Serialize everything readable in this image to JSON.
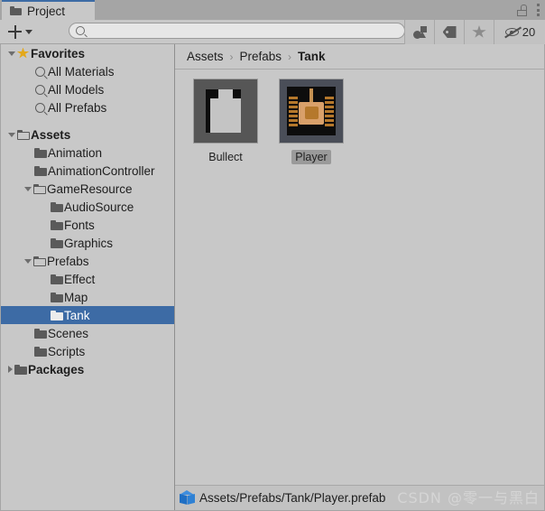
{
  "window": {
    "tab_label": "Project",
    "tab_icon": "folder-icon",
    "lock_icon": "lock-open-icon",
    "menu_icon": "kebab-menu-icon"
  },
  "toolbar": {
    "add_label": "+",
    "add_icon": "plus-icon",
    "add_dropdown_icon": "chevron-down-icon",
    "search": {
      "value": "",
      "placeholder": "",
      "icon": "search-icon"
    },
    "buttons": [
      {
        "name": "filter-by-type-button",
        "icon": "shapes-icon",
        "label": ""
      },
      {
        "name": "filter-by-label-button",
        "icon": "tag-icon",
        "label": ""
      },
      {
        "name": "filter-by-favorite-button",
        "icon": "star-icon",
        "label": ""
      },
      {
        "name": "hidden-items-button",
        "icon": "eye-off-icon",
        "label": "20"
      }
    ],
    "hidden_count": "20"
  },
  "sidebar": {
    "items": [
      {
        "label": "Favorites",
        "icon": "star-icon",
        "indent": 0,
        "twisty": "open",
        "bold": true,
        "selected": false
      },
      {
        "label": "All Materials",
        "icon": "search-icon",
        "indent": 1,
        "twisty": "none",
        "bold": false,
        "selected": false
      },
      {
        "label": "All Models",
        "icon": "search-icon",
        "indent": 1,
        "twisty": "none",
        "bold": false,
        "selected": false
      },
      {
        "label": "All Prefabs",
        "icon": "search-icon",
        "indent": 1,
        "twisty": "none",
        "bold": false,
        "selected": false
      },
      {
        "label": "Assets",
        "icon": "folder-open-icon",
        "indent": 0,
        "twisty": "open",
        "bold": true,
        "selected": false,
        "gap_before": true
      },
      {
        "label": "Animation",
        "icon": "folder-icon",
        "indent": 1,
        "twisty": "none",
        "bold": false,
        "selected": false
      },
      {
        "label": "AnimationController",
        "icon": "folder-icon",
        "indent": 1,
        "twisty": "none",
        "bold": false,
        "selected": false
      },
      {
        "label": "GameResource",
        "icon": "folder-open-icon",
        "indent": 1,
        "twisty": "open",
        "bold": false,
        "selected": false
      },
      {
        "label": "AudioSource",
        "icon": "folder-icon",
        "indent": 2,
        "twisty": "none",
        "bold": false,
        "selected": false
      },
      {
        "label": "Fonts",
        "icon": "folder-icon",
        "indent": 2,
        "twisty": "none",
        "bold": false,
        "selected": false
      },
      {
        "label": "Graphics",
        "icon": "folder-icon",
        "indent": 2,
        "twisty": "none",
        "bold": false,
        "selected": false
      },
      {
        "label": "Prefabs",
        "icon": "folder-open-icon",
        "indent": 1,
        "twisty": "open",
        "bold": false,
        "selected": false
      },
      {
        "label": "Effect",
        "icon": "folder-icon",
        "indent": 2,
        "twisty": "none",
        "bold": false,
        "selected": false
      },
      {
        "label": "Map",
        "icon": "folder-icon",
        "indent": 2,
        "twisty": "none",
        "bold": false,
        "selected": false
      },
      {
        "label": "Tank",
        "icon": "folder-icon-white",
        "indent": 2,
        "twisty": "none",
        "bold": false,
        "selected": true
      },
      {
        "label": "Scenes",
        "icon": "folder-icon",
        "indent": 1,
        "twisty": "none",
        "bold": false,
        "selected": false
      },
      {
        "label": "Scripts",
        "icon": "folder-icon",
        "indent": 1,
        "twisty": "none",
        "bold": false,
        "selected": false
      },
      {
        "label": "Packages",
        "icon": "folder-icon",
        "indent": 0,
        "twisty": "closed",
        "bold": true,
        "selected": false
      }
    ]
  },
  "breadcrumb": {
    "separator": "›",
    "items": [
      "Assets",
      "Prefabs",
      "Tank"
    ]
  },
  "content": {
    "assets": [
      {
        "name": "Bullect",
        "sprite": "bullet-sprite",
        "selected": false
      },
      {
        "name": "Player",
        "sprite": "tank-sprite",
        "selected": true
      }
    ]
  },
  "status_bar": {
    "icon": "prefab-cube-icon",
    "path": "Assets/Prefabs/Tank/Player.prefab"
  },
  "watermark": {
    "text": "CSDN @零一与黑白"
  },
  "colors": {
    "selection_blue": "#3d6ba5",
    "panel_bg": "#c8c8c8",
    "chrome_bg": "#a5a5a5",
    "thumb_bg": "#565656",
    "star_gold": "#e3a81b",
    "prefab_blue": "#2f81d4"
  }
}
